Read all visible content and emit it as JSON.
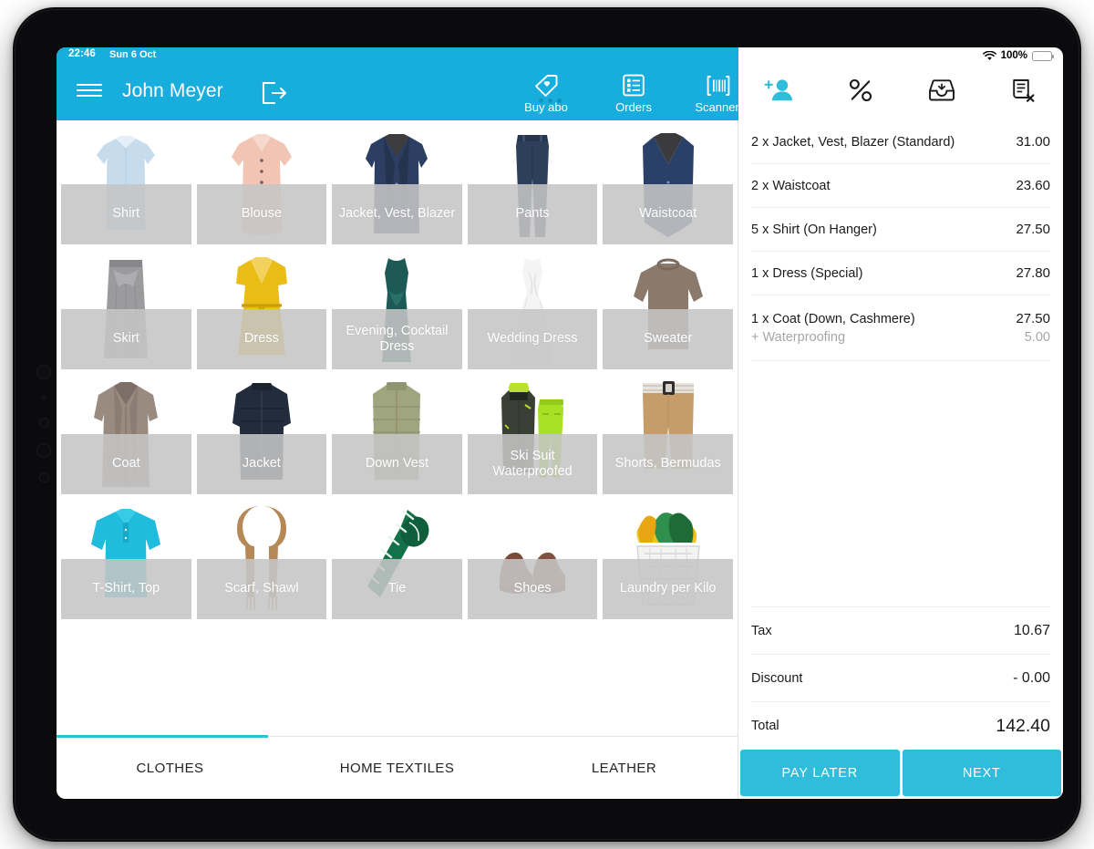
{
  "status_bar": {
    "time": "22:46",
    "date": "Sun 6 Oct",
    "battery_percent": "100%",
    "wifi_icon": "wifi-icon",
    "battery_icon": "battery-full-icon"
  },
  "header": {
    "menu_icon": "hamburger-menu-icon",
    "user_name": "John Meyer",
    "logout_icon": "logout-icon",
    "actions": [
      {
        "label": "Buy abo",
        "icon": "tag-heart-icon"
      },
      {
        "label": "Orders",
        "icon": "list-orders-icon"
      },
      {
        "label": "Scannen",
        "icon": "barcode-scan-icon"
      }
    ]
  },
  "panel_header": {
    "buttons": [
      {
        "icon": "add-customer-icon",
        "active": true
      },
      {
        "icon": "percent-discount-icon",
        "active": false
      },
      {
        "icon": "inbox-tray-icon",
        "active": false
      },
      {
        "icon": "delete-receipt-icon",
        "active": false
      }
    ]
  },
  "colors": {
    "accent_blue": "#17ADDC",
    "button_blue": "#30BDDC",
    "tile_label_bar": "#C5C5C5",
    "divider": "#EDEDED",
    "muted_text": "#A6A6A6"
  },
  "product_grid": {
    "tiles": [
      {
        "label": "Shirt",
        "art": "shirt"
      },
      {
        "label": "Blouse",
        "art": "blouse"
      },
      {
        "label": "Jacket, Vest, Blazer",
        "art": "blazer"
      },
      {
        "label": "Pants",
        "art": "pants"
      },
      {
        "label": "Waistcoat",
        "art": "waistcoat"
      },
      {
        "label": "Skirt",
        "art": "skirt"
      },
      {
        "label": "Dress",
        "art": "dress"
      },
      {
        "label": "Evening, Cocktail Dress",
        "art": "evening-dress"
      },
      {
        "label": "Wedding Dress",
        "art": "wedding-dress"
      },
      {
        "label": "Sweater",
        "art": "sweater"
      },
      {
        "label": "Coat",
        "art": "coat"
      },
      {
        "label": "Jacket",
        "art": "puffer-jacket"
      },
      {
        "label": "Down Vest",
        "art": "down-vest"
      },
      {
        "label": "Ski Suit Waterproofed",
        "art": "ski-suit"
      },
      {
        "label": "Shorts, Bermudas",
        "art": "shorts"
      },
      {
        "label": "T-Shirt, Top",
        "art": "polo-shirt"
      },
      {
        "label": "Scarf, Shawl",
        "art": "scarf"
      },
      {
        "label": "Tie",
        "art": "tie"
      },
      {
        "label": "Shoes",
        "art": "shoes"
      },
      {
        "label": "Laundry per Kilo",
        "art": "laundry-basket"
      }
    ]
  },
  "category_tabs": {
    "items": [
      {
        "label": "CLOTHES",
        "selected": true
      },
      {
        "label": "HOME TEXTILES",
        "selected": false
      },
      {
        "label": "LEATHER",
        "selected": false
      }
    ]
  },
  "cart": {
    "items": [
      {
        "name": "2 x Jacket, Vest, Blazer (Standard)",
        "price": "31.00"
      },
      {
        "name": "2 x Waistcoat",
        "price": "23.60"
      },
      {
        "name": "5 x Shirt (On Hanger)",
        "price": "27.50"
      },
      {
        "name": "1 x Dress (Special)",
        "price": "27.80"
      },
      {
        "name": "1 x Coat (Down, Cashmere)",
        "price": "27.50",
        "addon_name": "+ Waterproofing",
        "addon_price": "5.00"
      }
    ],
    "totals": [
      {
        "label": "Tax",
        "value": "10.67"
      },
      {
        "label": "Discount",
        "value": "- 0.00"
      },
      {
        "label": "Total",
        "value": "142.40"
      }
    ],
    "actions": {
      "pay_later": "PAY LATER",
      "next": "NEXT"
    }
  }
}
